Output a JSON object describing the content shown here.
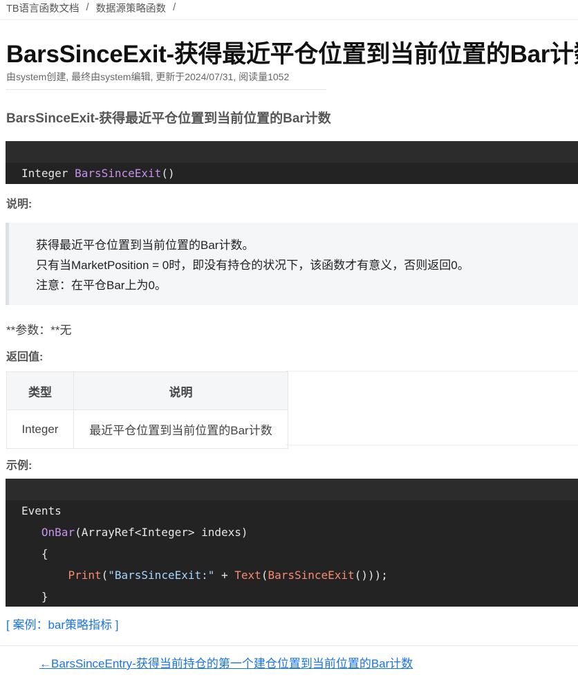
{
  "breadcrumb": {
    "items": [
      "TB语言函数文档",
      "数据源策略函数"
    ],
    "separator": "/"
  },
  "title": "BarsSinceExit-获得最近平仓位置到当前位置的Bar计数",
  "meta": "由system创建, 最终由system编辑, 更新于2024/07/31, 阅读量1052",
  "subheading": "BarsSinceExit-获得最近平仓位置到当前位置的Bar计数",
  "signature": {
    "return_type": "Integer",
    "func": "BarsSinceExit",
    "parens": "()"
  },
  "description_label": "说明:",
  "description_lines": [
    "获得最近平仓位置到当前位置的Bar计数。",
    "只有当MarketPosition = 0时，即没有持仓的状况下，该函数才有意义，否则返回0。",
    "注意：在平仓Bar上为0。"
  ],
  "params_text": "**参数：**无",
  "return_label": "返回值:",
  "table": {
    "headers": [
      "类型",
      "说明"
    ],
    "rows": [
      [
        "Integer",
        "最近平仓位置到当前位置的Bar计数"
      ]
    ]
  },
  "example_label": "示例:",
  "example": {
    "line1": "Events",
    "onbar": "OnBar",
    "onbar_args": "(ArrayRef<Integer> indexs)",
    "open_brace": "{",
    "print": "Print",
    "paren_open": "(",
    "string": "\"BarsSinceExit:\"",
    "plus": " + ",
    "text_fn": "Text",
    "inner_fn": "BarsSinceExit",
    "tail": "()));",
    "close_brace": "}"
  },
  "case_link": "[ 案例：bar策略指标 ]",
  "prev_link": "←BarsSinceEntry-获得当前持仓的第一个建仓位置到当前位置的Bar计数",
  "colors": {
    "link": "#1a73e8",
    "code_bg": "#232323",
    "keyword": "#c792ea",
    "call": "#f78c6c",
    "string": "#a5d6ff"
  }
}
